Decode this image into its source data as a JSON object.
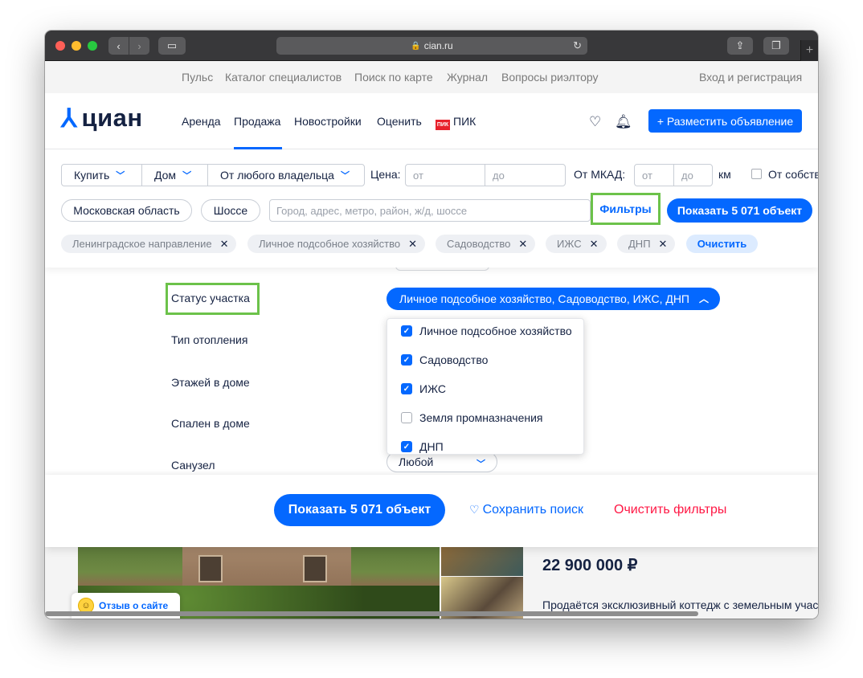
{
  "browser": {
    "url": "cian.ru"
  },
  "toplinks": [
    "Пульс",
    "Каталог специалистов",
    "Поиск по карте",
    "Журнал",
    "Вопросы риэлтору"
  ],
  "login": "Вход и регистрация",
  "logo": "циан",
  "nav": {
    "rent": "Аренда",
    "sale": "Продажа",
    "new": "Новостройки",
    "estimate": "Оценить",
    "pik_badge": "ПИК",
    "pik": "ПИК"
  },
  "post_button": "+ Разместить объявление",
  "filters": {
    "deal": "Купить",
    "type": "Дом",
    "owner": "От любого владельца",
    "price_label": "Цена:",
    "price_from": "от",
    "price_to": "до",
    "mkad_label": "От МКАД:",
    "mkad_from": "от",
    "mkad_to": "до",
    "km": "км",
    "owner_checkbox": "От собств",
    "region": "Московская область",
    "highway": "Шоссе",
    "search_placeholder": "Город, адрес, метро, район, ж/д, шоссе",
    "filters_link": "Фильтры",
    "show_button": "Показать 5 071 объект",
    "tags": [
      "Ленинградское направление",
      "Личное подсобное хозяйство",
      "Садоводство",
      "ИЖС",
      "ДНП"
    ],
    "clear": "Очистить"
  },
  "panel": {
    "status_label": "Статус участка",
    "heating_label": "Тип отопления",
    "floors_label": "Этажей в доме",
    "bedrooms_label": "Спален в доме",
    "bathroom_label": "Санузел",
    "status_value": "Личное подсобное хозяйство, Садоводство, ИЖС, ДНП",
    "options": [
      {
        "label": "Личное подсобное хозяйство",
        "checked": true
      },
      {
        "label": "Садоводство",
        "checked": true
      },
      {
        "label": "ИЖС",
        "checked": true
      },
      {
        "label": "Земля промназначения",
        "checked": false
      },
      {
        "label": "ДНП",
        "checked": true
      }
    ],
    "bathroom_value": "Любой"
  },
  "actions": {
    "show": "Показать 5 071 объект",
    "save": "Сохранить поиск",
    "clear": "Очистить фильтры"
  },
  "listing": {
    "price": "22 900 000 ₽",
    "description": "Продаётся эксклюзивный коттедж с земельным учас"
  },
  "feedback": "Отзыв о сайте"
}
